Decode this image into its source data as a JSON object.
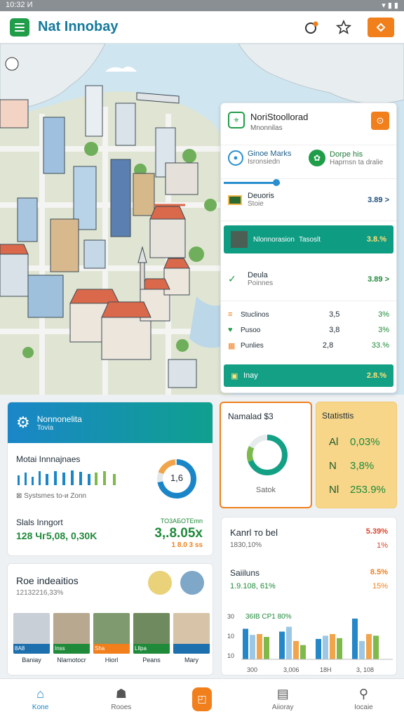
{
  "status_bar": {
    "time": "10:32 И"
  },
  "app_bar": {
    "title": "Nat Innobay"
  },
  "map_panel": {
    "title": "NoriStoollorad",
    "subtitle": "Mnonnilas",
    "user_a": {
      "name": "Ginoe Marks",
      "sub": "Isronsiedn"
    },
    "user_b": {
      "name": "Dorpe his",
      "sub": "Haprnsn ta dralie"
    },
    "rows": [
      {
        "label": "Deuoris",
        "sub": "Stoie",
        "value": "3.89 >"
      },
      {
        "label": "Nlonnorasion",
        "sub": "Tasoslt",
        "value": "3.8.%",
        "highlight": true
      },
      {
        "label": "Deula",
        "sub": "Poinnes",
        "value": "3.89 >"
      }
    ],
    "stats": [
      {
        "label": "Stuclinos",
        "num": "3,5",
        "pct": "3%"
      },
      {
        "label": "Pusoo",
        "num": "3,8",
        "pct": "3%"
      },
      {
        "label": "Punlies",
        "num": "2,8",
        "pct": "33.%"
      }
    ],
    "footer": {
      "label": "Inay",
      "value": "2.8.%"
    }
  },
  "card_innov": {
    "title": "Nonnonelita",
    "subtitle": "Tovia",
    "metric_label": "Motai Innnajnaes",
    "donut_label": "1,6",
    "donut_value": 0.72,
    "note": "Systsmes to-и Zonn",
    "footer_label": "Slals Inngort",
    "footer_left": "128 Чг5,08, 0,30K",
    "footer_right_small": "TO3АБОТEmn",
    "footer_right_big": "3,.8.05x",
    "footer_right_sub": "1 8.0 3 ss"
  },
  "card_named": {
    "title": "Namalad $3",
    "center_label": "Satok",
    "ring_value": 0.82
  },
  "card_stats": {
    "title": "Statisttis",
    "rows": [
      {
        "key": "Al",
        "value": "0,03%"
      },
      {
        "key": "N",
        "value": "3,8%"
      },
      {
        "key": "Nl",
        "value": "253.9%"
      }
    ]
  },
  "card_reso": {
    "title": "Roe indeaitios",
    "subtitle": "12132216,33%",
    "thumbs": [
      {
        "label": "Baniay",
        "tag": "8A8"
      },
      {
        "label": "Nlarnotocr",
        "tag": "Inss"
      },
      {
        "label": "Hiorl",
        "tag": "Sha"
      },
      {
        "label": "Peans",
        "tag": "Lllpa"
      },
      {
        "label": "Mary",
        "tag": ""
      }
    ]
  },
  "card_kanrl": {
    "title": "Kanrl то bel",
    "sub": "1830,10%",
    "right_top": "5.39%",
    "right_sub": "1%",
    "sect_title": "Saiiluns",
    "sect_sub": "1.9.108, 61%",
    "sect_right_top": "8.5%",
    "sect_right_sub": "15%",
    "legend": "36ІВ СР1 80%"
  },
  "bar_chart": {
    "y_ticks": [
      "30",
      "10",
      "10"
    ],
    "x_labels": [
      "300",
      "3,006",
      "18H",
      "3, 108"
    ],
    "groups": [
      [
        0.75,
        0.6,
        0.62,
        0.55
      ],
      [
        0.68,
        0.8,
        0.45,
        0.35
      ],
      [
        0.5,
        0.58,
        0.62,
        0.52
      ],
      [
        1.0,
        0.45,
        0.62,
        0.58
      ]
    ],
    "colors": [
      "#2387c8",
      "#9cc8e6",
      "#f2a44a",
      "#7dba4a"
    ]
  },
  "bottom_nav": [
    {
      "label": "Kone",
      "icon": "home-icon",
      "active": true
    },
    {
      "label": "Rooes",
      "icon": "people-icon"
    },
    {
      "label": "",
      "icon": "center-icon"
    },
    {
      "label": "Aiioray",
      "icon": "doc-icon"
    },
    {
      "label": "Iocaie",
      "icon": "search-icon"
    }
  ],
  "colors": {
    "brand_green": "#1f9d48",
    "teal": "#13a085",
    "orange": "#f07f1c",
    "title_blue": "#157a9c"
  }
}
